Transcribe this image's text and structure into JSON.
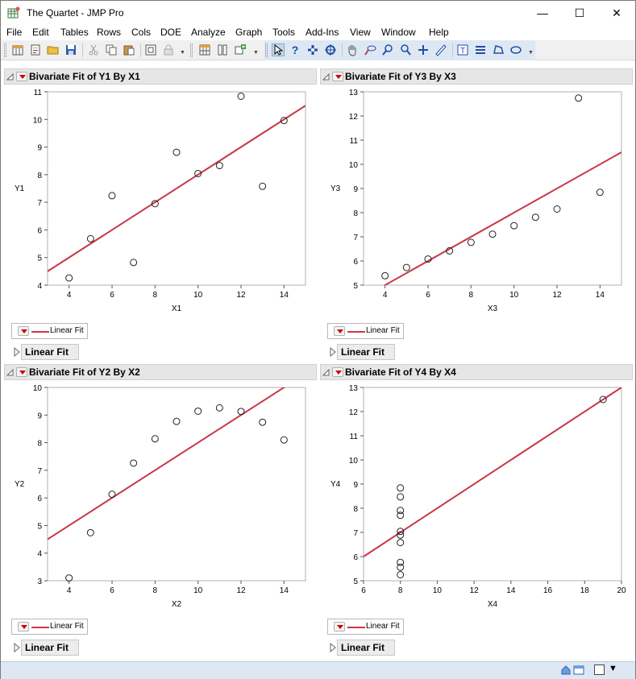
{
  "window": {
    "title": "The Quartet - JMP Pro",
    "minimize": "—",
    "maximize": "☐",
    "close": "✕"
  },
  "menu": [
    "File",
    "Edit",
    "Tables",
    "Rows",
    "Cols",
    "DOE",
    "Analyze",
    "Graph",
    "Tools",
    "Add-Ins",
    "View",
    "Window",
    "Help"
  ],
  "toolbar_icons": [
    "new-table-icon",
    "new-script-icon",
    "open-icon",
    "save-icon",
    "cut-icon",
    "copy-icon",
    "paste-icon",
    "data-view-icon",
    "lock-icon",
    "table-icon",
    "columns-icon",
    "add-icon",
    "arrow-icon",
    "help-icon",
    "brush-icon",
    "crosshair-icon",
    "hand-icon",
    "lasso-icon",
    "zoom-icon",
    "plus-icon",
    "ruler-icon",
    "annotate-icon",
    "lines-icon",
    "polygon-icon",
    "ellipse-icon"
  ],
  "colors": {
    "fit_line": "#c8384a",
    "point_stroke": "#222222",
    "red_triangle": "#d00000"
  },
  "panels": [
    {
      "header": "Bivariate Fit of Y1 By X1",
      "legend": "Linear Fit",
      "section": "Linear Fit"
    },
    {
      "header": "Bivariate Fit of Y3 By X3",
      "legend": "Linear Fit",
      "section": "Linear Fit"
    },
    {
      "header": "Bivariate Fit of Y2 By X2",
      "legend": "Linear Fit",
      "section": "Linear Fit"
    },
    {
      "header": "Bivariate Fit of Y4 By X4",
      "legend": "Linear Fit",
      "section": "Linear Fit"
    }
  ],
  "chart_data": [
    {
      "type": "scatter",
      "xlabel": "X1",
      "ylabel": "Y1",
      "xlim": [
        3,
        15
      ],
      "ylim": [
        4,
        11
      ],
      "xticks": [
        4,
        6,
        8,
        10,
        12,
        14
      ],
      "yticks": [
        4,
        5,
        6,
        7,
        8,
        9,
        10,
        11
      ],
      "x": [
        10,
        8,
        13,
        9,
        11,
        14,
        6,
        4,
        12,
        7,
        5
      ],
      "y": [
        8.04,
        6.95,
        7.58,
        8.81,
        8.33,
        9.96,
        7.24,
        4.26,
        10.84,
        4.82,
        5.68
      ],
      "fit": {
        "intercept": 3.0,
        "slope": 0.5
      }
    },
    {
      "type": "scatter",
      "xlabel": "X3",
      "ylabel": "Y3",
      "xlim": [
        3,
        15
      ],
      "ylim": [
        5,
        13
      ],
      "xticks": [
        4,
        6,
        8,
        10,
        12,
        14
      ],
      "yticks": [
        5,
        6,
        7,
        8,
        9,
        10,
        11,
        12,
        13
      ],
      "x": [
        10,
        8,
        13,
        9,
        11,
        14,
        6,
        4,
        12,
        7,
        5
      ],
      "y": [
        7.46,
        6.77,
        12.74,
        7.11,
        7.81,
        8.84,
        6.08,
        5.39,
        8.15,
        6.42,
        5.73
      ],
      "fit": {
        "intercept": 3.0,
        "slope": 0.5
      }
    },
    {
      "type": "scatter",
      "xlabel": "X2",
      "ylabel": "Y2",
      "xlim": [
        3,
        15
      ],
      "ylim": [
        3,
        10
      ],
      "xticks": [
        4,
        6,
        8,
        10,
        12,
        14
      ],
      "yticks": [
        3,
        4,
        5,
        6,
        7,
        8,
        9,
        10
      ],
      "x": [
        10,
        8,
        13,
        9,
        11,
        14,
        6,
        4,
        12,
        7,
        5
      ],
      "y": [
        9.14,
        8.14,
        8.74,
        8.77,
        9.26,
        8.1,
        6.13,
        3.1,
        9.13,
        7.26,
        4.74
      ],
      "fit": {
        "intercept": 3.0,
        "slope": 0.5
      }
    },
    {
      "type": "scatter",
      "xlabel": "X4",
      "ylabel": "Y4",
      "xlim": [
        6,
        20
      ],
      "ylim": [
        5,
        13
      ],
      "xticks": [
        6,
        8,
        10,
        12,
        14,
        16,
        18,
        20
      ],
      "yticks": [
        5,
        6,
        7,
        8,
        9,
        10,
        11,
        12,
        13
      ],
      "x": [
        8,
        8,
        8,
        8,
        8,
        8,
        8,
        19,
        8,
        8,
        8
      ],
      "y": [
        6.58,
        5.76,
        7.71,
        8.84,
        8.47,
        7.04,
        5.25,
        12.5,
        5.56,
        7.91,
        6.89
      ],
      "fit": {
        "intercept": 3.0,
        "slope": 0.5
      }
    }
  ]
}
